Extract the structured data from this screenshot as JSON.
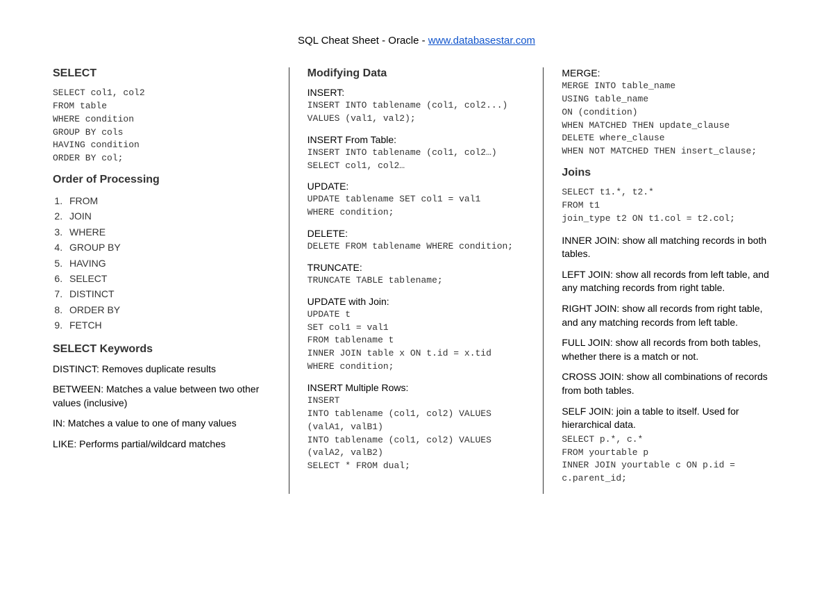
{
  "header": {
    "prefix": "SQL Cheat Sheet - Oracle - ",
    "link": "www.databasestar.com"
  },
  "col1": {
    "select_heading": "SELECT",
    "select_code": "SELECT col1, col2\nFROM table\nWHERE condition\nGROUP BY cols\nHAVING condition\nORDER BY col;",
    "order_heading": "Order of Processing",
    "order_items": [
      "FROM",
      "JOIN",
      "WHERE",
      "GROUP BY",
      "HAVING",
      "SELECT",
      "DISTINCT",
      "ORDER BY",
      "FETCH"
    ],
    "keywords_heading": "SELECT Keywords",
    "kw_distinct": "DISTINCT: Removes duplicate results",
    "kw_between": "BETWEEN: Matches a value between two other values (inclusive)",
    "kw_in": "IN: Matches a value to one of many values",
    "kw_like": "LIKE: Performs partial/wildcard matches"
  },
  "col2": {
    "modifying_heading": "Modifying Data",
    "insert_label": "INSERT:",
    "insert_code": "INSERT INTO tablename (col1, col2...)\nVALUES (val1, val2);",
    "insert_from_label": "INSERT From Table:",
    "insert_from_code": "INSERT INTO tablename (col1, col2…)\nSELECT col1, col2…",
    "update_label": "UPDATE:",
    "update_code": "UPDATE tablename SET col1 = val1\nWHERE condition;",
    "delete_label": "DELETE:",
    "delete_code": "DELETE FROM tablename WHERE condition;",
    "truncate_label": "TRUNCATE:",
    "truncate_code": "TRUNCATE TABLE tablename;",
    "update_join_label": "UPDATE with Join:",
    "update_join_code": "UPDATE t\nSET col1 = val1\nFROM tablename t\nINNER JOIN table x ON t.id = x.tid\nWHERE condition;",
    "insert_multi_label": "INSERT Multiple Rows:",
    "insert_multi_code": "INSERT\nINTO tablename (col1, col2) VALUES\n(valA1, valB1)\nINTO tablename (col1, col2) VALUES\n(valA2, valB2)\nSELECT * FROM dual;"
  },
  "col3": {
    "merge_label": "MERGE:",
    "merge_code": "MERGE INTO table_name\nUSING table_name\nON (condition)\nWHEN MATCHED THEN update_clause\nDELETE where_clause\nWHEN NOT MATCHED THEN insert_clause;",
    "joins_heading": "Joins",
    "joins_code": "SELECT t1.*, t2.*\nFROM t1\njoin_type t2 ON t1.col = t2.col;",
    "inner_join": "INNER JOIN: show all matching records in both tables.",
    "left_join": "LEFT JOIN: show all records from left table, and any matching records from right table.",
    "right_join": "RIGHT JOIN: show all records from right table, and any matching records from left table.",
    "full_join": "FULL JOIN: show all records from both tables, whether there is a match or not.",
    "cross_join": "CROSS JOIN: show all combinations of records from both tables.",
    "self_join": "SELF JOIN: join a table to itself. Used for hierarchical data.",
    "self_join_code": "SELECT p.*, c.*\nFROM yourtable p\nINNER JOIN yourtable c ON p.id =\nc.parent_id;"
  }
}
